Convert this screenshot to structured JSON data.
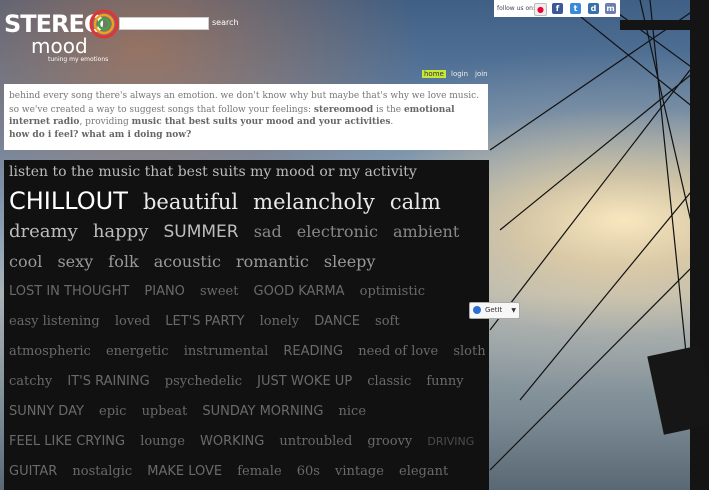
{
  "brand": {
    "name_top": "STEREO",
    "name_bottom": "mood",
    "tagline": "tuning my emotions",
    "accent": "#c6e63a"
  },
  "search": {
    "value": "",
    "button_label": "search"
  },
  "follow": {
    "label": "follow us on:",
    "icons": [
      "flickr-icon",
      "facebook-icon",
      "twitter-icon",
      "delicious-icon",
      "myspace-icon"
    ]
  },
  "nav": {
    "home": "home",
    "login": "login",
    "join": "join"
  },
  "intro": {
    "line1": "behind every song there's always an emotion. we don't know why but maybe that's why we love music.",
    "line2_a": "so we've created a way to suggest songs that follow your feelings: ",
    "line2_b": "stereomood",
    "line2_c": " is the ",
    "line2_d": "emotional internet radio",
    "line2_e": ", providing ",
    "line2_f": "music that best suits your mood and your activities",
    "line2_g": ".",
    "question": "how do i feel? what am i doing now?"
  },
  "cloud": {
    "heading": "listen to the music that best suits my mood or my activity",
    "rows": [
      [
        "CHILLOUT",
        "beautiful",
        "melancholy",
        "calm"
      ],
      [
        "dreamy",
        "happy",
        "SUMMER",
        "sad",
        "electronic",
        "ambient"
      ],
      [
        "cool",
        "sexy",
        "folk",
        "acoustic",
        "romantic",
        "sleepy"
      ],
      [
        "LOST IN THOUGHT",
        "PIANO",
        "sweet",
        "GOOD KARMA",
        "optimistic"
      ],
      [
        "easy listening",
        "loved",
        "LET'S PARTY",
        "lonely",
        "DANCE",
        "soft"
      ],
      [
        "atmospheric",
        "energetic",
        "instrumental",
        "READING",
        "need of love",
        "sloth"
      ],
      [
        "catchy",
        "IT'S RAINING",
        "psychedelic",
        "JUST WOKE UP",
        "classic",
        "funny"
      ],
      [
        "SUNNY DAY",
        "epic",
        "upbeat",
        "SUNDAY MORNING",
        "nice"
      ],
      [
        "FEEL LIKE CRYING",
        "lounge",
        "WORKING",
        "untroubled",
        "groovy",
        "DRIVING"
      ],
      [
        "GUITAR",
        "nostalgic",
        "MAKE LOVE",
        "female",
        "60s",
        "vintage",
        "elegant"
      ]
    ]
  },
  "getit": {
    "label": "GetIt"
  }
}
